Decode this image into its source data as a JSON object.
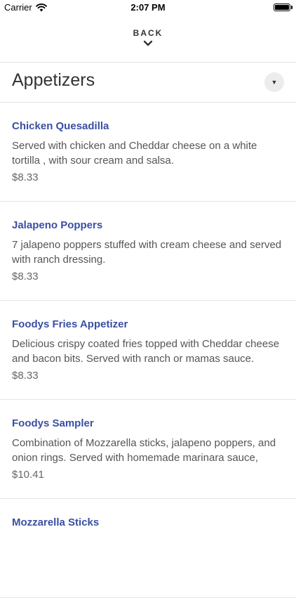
{
  "status_bar": {
    "carrier": "Carrier",
    "time": "2:07 PM"
  },
  "nav": {
    "back_label": "BACK"
  },
  "section": {
    "title": "Appetizers"
  },
  "items": [
    {
      "name": "Chicken Quesadilla",
      "description": "Served with chicken and Cheddar cheese on a white tortilla , with sour cream and salsa.",
      "price": "$8.33"
    },
    {
      "name": "Jalapeno Poppers",
      "description": "7 jalapeno poppers stuffed with cream cheese and served with ranch dressing.",
      "price": "$8.33"
    },
    {
      "name": "Foodys Fries Appetizer",
      "description": "Delicious crispy coated fries topped with Cheddar cheese and bacon bits. Served with ranch or mamas sauce.",
      "price": "$8.33"
    },
    {
      "name": "Foodys Sampler",
      "description": "Combination of Mozzarella sticks, jalapeno poppers, and onion rings. Served with homemade marinara sauce,",
      "price": "$10.41"
    },
    {
      "name": "Mozzarella Sticks",
      "description": "",
      "price": ""
    }
  ],
  "colors": {
    "item_name": "#3a4fa3",
    "divider": "#e5e5e5",
    "dropdown_bg": "#ececec"
  }
}
